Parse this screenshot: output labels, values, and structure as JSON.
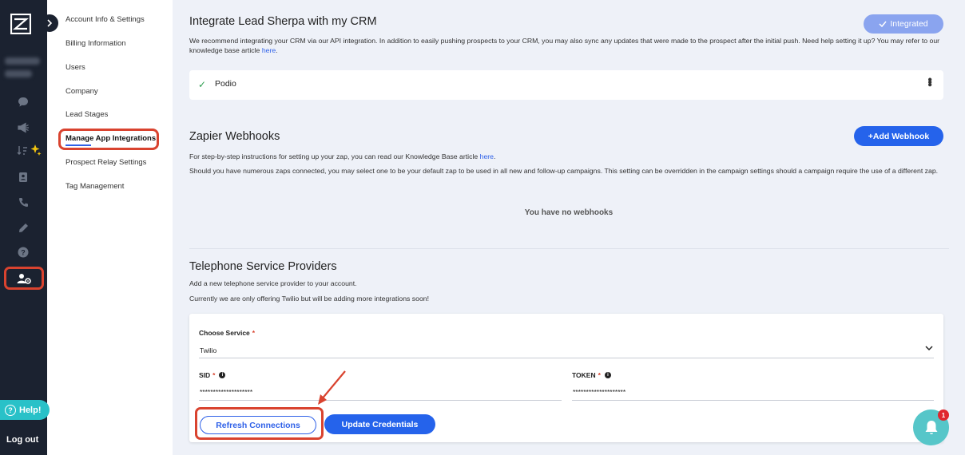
{
  "rail": {
    "icons": [
      "messages-icon",
      "megaphone-icon",
      "sort-sparkle-icon",
      "contact-book-icon",
      "phone-icon",
      "pencil-icon",
      "help-circle-icon",
      "user-settings-icon"
    ],
    "help_label": "Help!",
    "logout_label": "Log out",
    "accent": "#d9432f"
  },
  "submenu": {
    "items": [
      {
        "label": "Account Info & Settings"
      },
      {
        "label": "Billing Information"
      },
      {
        "label": "Users"
      },
      {
        "label": "Company"
      },
      {
        "label": "Lead Stages"
      },
      {
        "label": "Manage App Integrations"
      },
      {
        "label": "Prospect Relay Settings"
      },
      {
        "label": "Tag Management"
      }
    ],
    "active_index": 5
  },
  "crm": {
    "title": "Integrate Lead Sherpa with my CRM",
    "status_label": "Integrated",
    "description": "We recommend integrating your CRM via our API integration. In addition to easily pushing prospects to your CRM, you may also sync any updates that were made to the prospect after the initial push. Need help setting it up? You may refer to our knowledge base article",
    "link_text": "here",
    "link_suffix": ".",
    "integration_name": "Podio"
  },
  "zapier": {
    "title": "Zapier Webhooks",
    "add_label": "+Add Webhook",
    "line1": "For step-by-step instructions for setting up your zap, you can read our Knowledge Base article",
    "line1_link": "here",
    "line1_suffix": ".",
    "line2": "Should you have numerous zaps connected, you may select one to be your default zap to be used in all new and follow-up campaigns. This setting can be overridden in the campaign settings should a campaign require the use of a different zap.",
    "empty": "You have no webhooks"
  },
  "telephone": {
    "title": "Telephone Service Providers",
    "line1": "Add a new telephone service provider to your account.",
    "line2": "Currently we are only offering Twilio but will be adding more integrations soon!",
    "choose_label": "Choose Service",
    "choose_value": "Twilio",
    "sid_label": "SID",
    "sid_value": "********************",
    "token_label": "TOKEN",
    "token_value": "********************",
    "required_mark": "*",
    "refresh_label": "Refresh Connections",
    "update_label": "Update Credentials"
  },
  "notifications": {
    "count": "1"
  }
}
